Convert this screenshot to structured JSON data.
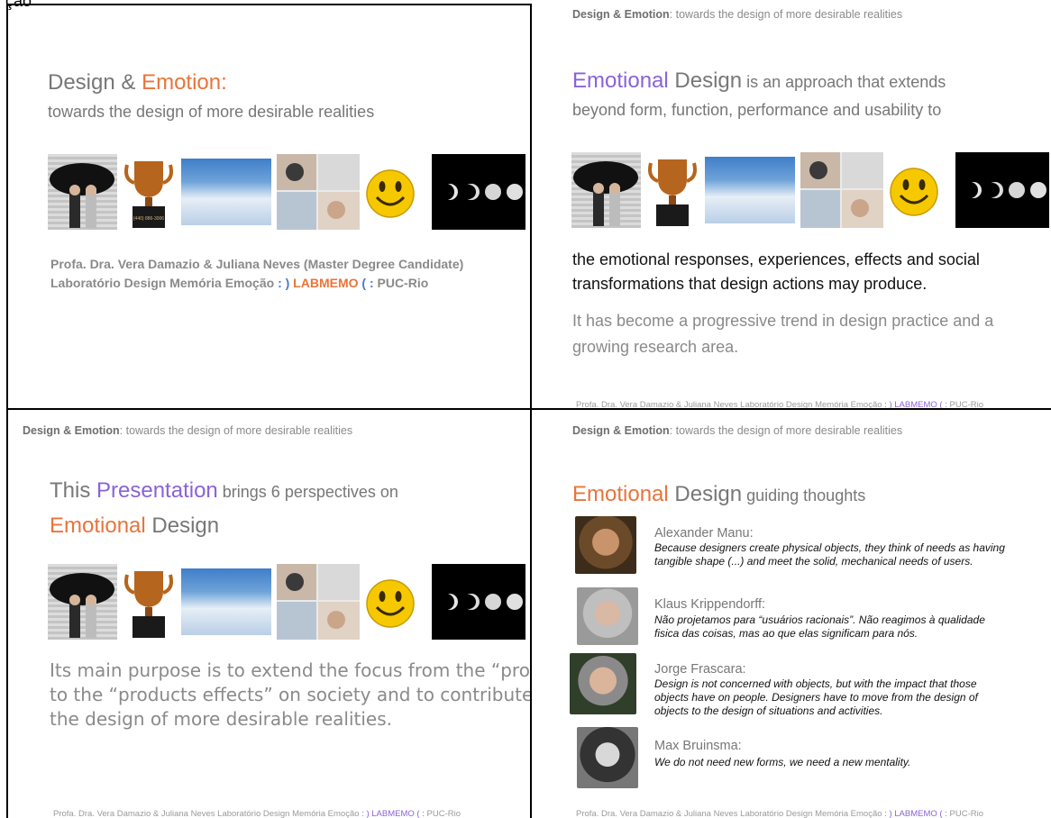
{
  "heading": "ção",
  "running_header": {
    "lead": "Design & ",
    "accent": "Emotion",
    "rest": ": towards the design of more desirable realities"
  },
  "footer": {
    "text": "Profa. Dra. Vera Damazio & Juliana Neves Laboratório Design Memória Emoção ",
    "smile": ": )",
    "lab": " LABMEMO ",
    "frown": "( :",
    "inst": "  PUC-Rio"
  },
  "slide1": {
    "title_lead": "Design & ",
    "title_accent": "Emotion:",
    "subtitle": "towards the design of more desirable realities",
    "credit_line1": "Profa. Dra. Vera Damazio & Juliana Neves (Master Degree Candidate)",
    "credit_line2_lead": "Laboratório Design Memória Emoção ",
    "credit_smile": ": )",
    "credit_lab": " LABMEMO ",
    "credit_frown": "( :",
    "credit_inst": "  PUC-Rio"
  },
  "slide2": {
    "title_accent": "Emotional",
    "title_word": " Design",
    "title_rest": " is an approach that extends",
    "line2": "beyond form, function, performance and usability to",
    "black_line1": "the emotional responses, experiences, effects and social",
    "black_line2": "transformations that design actions may produce.",
    "grey_line1": "It has become a progressive trend in design practice and a",
    "grey_line2": "growing research area."
  },
  "slide3": {
    "title_lead": "This ",
    "title_accent": "Presentation",
    "title_rest": " brings 6 perspectives on",
    "title2_accent": "Emotional",
    "title2_rest": " Design",
    "para_line1": "Its main purpose is to extend the focus from the “products",
    "para_line2": "to the “products effects” on society and to contribute with",
    "para_line3": "the design of more desirable realities."
  },
  "slide4": {
    "title_accent": "Emotional",
    "title_word": " Design",
    "title_rest": " guiding thoughts",
    "people": [
      {
        "name": "Alexander Manu:",
        "quote1": "Because designers create physical objects, they think of needs as having",
        "quote2": "tangible shape (...) and meet the solid, mechanical needs of users.",
        "quote3": ""
      },
      {
        "name": "Klaus Krippendorff:",
        "quote1": "Não projetamos para “usuários racionais”. Não reagimos à qualidade",
        "quote2": "fisica das coisas, mas ao que elas significam para nós.",
        "quote3": ""
      },
      {
        "name": "Jorge Frascara:",
        "quote1": "Design is not concerned with objects, but with the impact that those",
        "quote2": "objects have on people. Designers have to move from the design of",
        "quote3": "objects to the design of situations and activities."
      },
      {
        "name": "Max Bruinsma:",
        "quote1": "We do not need new forms, we need a new mentality.",
        "quote2": "",
        "quote3": ""
      }
    ]
  },
  "colors": {
    "orange": "#e8743b",
    "purple": "#8a63d6",
    "blue": "#4a78d0",
    "grey": "#808080"
  },
  "image_strip": [
    "umbrella-couple-photo",
    "trophy-photo",
    "sky-clouds-photo",
    "hands-collage-photo",
    "smiley-face-icon",
    "moon-phases-photo"
  ],
  "trophy_plate": "(440) 886-3006"
}
